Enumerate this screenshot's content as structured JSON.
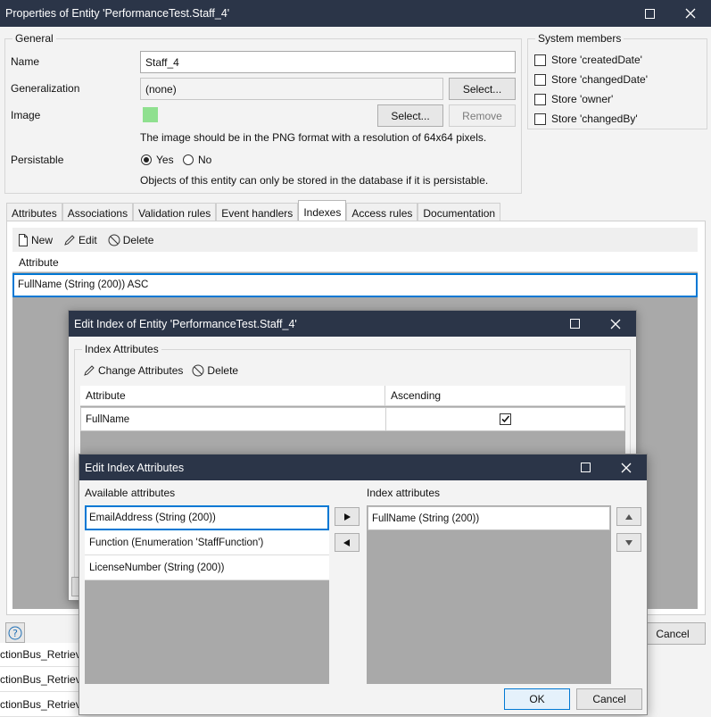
{
  "main": {
    "title": "Properties of Entity 'PerformanceTest.Staff_4'",
    "general_label": "General",
    "name_label": "Name",
    "name_value": "Staff_4",
    "generalization_label": "Generalization",
    "generalization_value": "(none)",
    "select_label": "Select...",
    "image_label": "Image",
    "image_select_label": "Select...",
    "remove_label": "Remove",
    "image_hint": "The image should be in the PNG format with a resolution of 64x64 pixels.",
    "persistable_label": "Persistable",
    "yes_label": "Yes",
    "no_label": "No",
    "persistable_hint": "Objects of this entity can only be stored in the database if it is persistable.",
    "system_members_label": "System members",
    "system_members": [
      "Store 'createdDate'",
      "Store 'changedDate'",
      "Store 'owner'",
      "Store 'changedBy'"
    ],
    "tabs": [
      "Attributes",
      "Associations",
      "Validation rules",
      "Event handlers",
      "Indexes",
      "Access rules",
      "Documentation"
    ],
    "active_tab": "Indexes",
    "toolbar": {
      "new": "New",
      "edit": "Edit",
      "delete": "Delete"
    },
    "index_list_header": "Attribute",
    "index_rows": [
      "FullName (String (200)) ASC"
    ],
    "cancel_label": "Cancel",
    "help_icon": "question-icon"
  },
  "background_items": [
    "ctionBus_Retrieve",
    "ctionBus_Retrieve",
    "ctionBus_Retrieve"
  ],
  "edit_index": {
    "title": "Edit Index of Entity 'PerformanceTest.Staff_4'",
    "group_label": "Index Attributes",
    "toolbar": {
      "change": "Change Attributes",
      "delete": "Delete"
    },
    "columns": [
      "Attribute",
      "Ascending"
    ],
    "rows": [
      {
        "attribute": "FullName",
        "ascending": true
      }
    ]
  },
  "edit_attrs": {
    "title": "Edit Index Attributes",
    "available_label": "Available attributes",
    "available": [
      "EmailAddress (String (200))",
      "Function (Enumeration 'StaffFunction')",
      "LicenseNumber (String (200))"
    ],
    "index_label": "Index attributes",
    "index_attrs": [
      "FullName (String (200))"
    ],
    "ok_label": "OK",
    "cancel_label": "Cancel"
  },
  "colors": {
    "titlebar": "#2b3548",
    "accent": "#0078d4",
    "image_swatch": "#8fe08f"
  }
}
